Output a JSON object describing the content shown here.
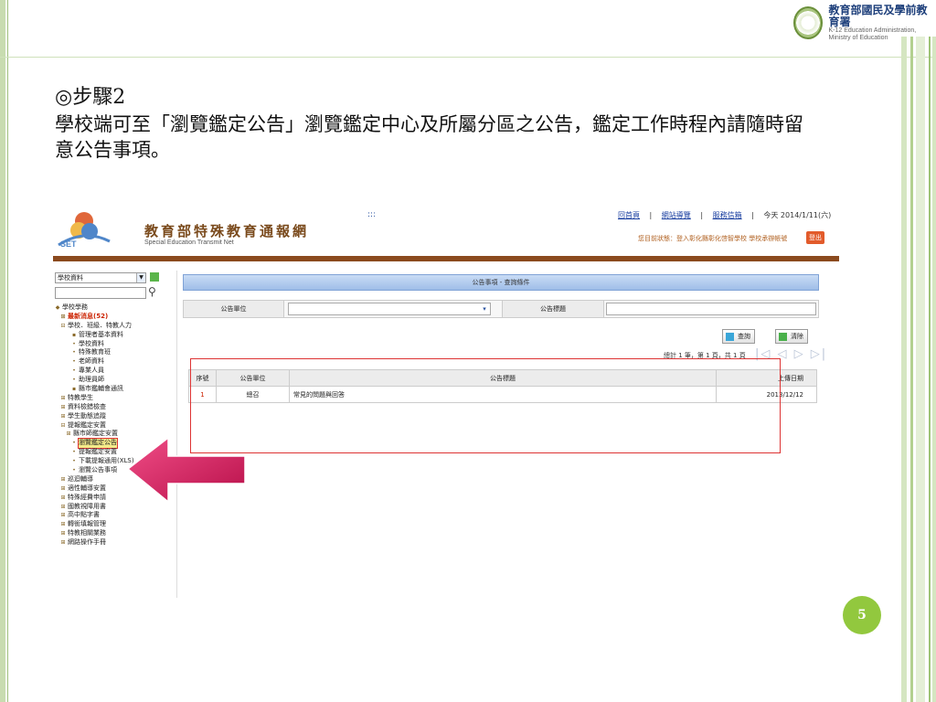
{
  "slide": {
    "step_title": "◎步驟2",
    "description": "學校端可至「瀏覽鑑定公告」瀏覽鑑定中心及所屬分區之公告，鑑定工作時程內請隨時留意公告事項。",
    "page_number": "5",
    "logo": {
      "zh": "教育部國民及學前教育署",
      "en1": "K-12 Education Administration,",
      "en2": "Ministry of Education"
    }
  },
  "site": {
    "title": "教育部特殊教育通報網",
    "subtitle": "Special Education Transmit Net",
    "logo_text": "SET",
    "dots": ":::",
    "top_links": [
      "回首頁",
      "網站導覽",
      "服務信箱"
    ],
    "sep": "|",
    "date_text": "今天 2014/1/11(六)",
    "status": "您目前狀態：登入彰化縣彰化啓智學校 學校承辦帳號",
    "logout": "登出"
  },
  "sidebar": {
    "select_value": "學校資料",
    "tree": [
      {
        "label": "學校學務",
        "cls": "",
        "ind": 0,
        "icon": "◆"
      },
      {
        "label": "最新消息(52)",
        "cls": "red",
        "ind": 1,
        "icon": "⊞"
      },
      {
        "label": "學校．班級．特教人力",
        "cls": "",
        "ind": 1,
        "icon": "⊟"
      },
      {
        "label": "管理者基本資料",
        "cls": "",
        "ind": 3,
        "icon": "▪"
      },
      {
        "label": "學校資料",
        "cls": "",
        "ind": 3,
        "icon": "•"
      },
      {
        "label": "特殊教育班",
        "cls": "",
        "ind": 3,
        "icon": "•"
      },
      {
        "label": "老師資料",
        "cls": "",
        "ind": 3,
        "icon": "•"
      },
      {
        "label": "專業人員",
        "cls": "",
        "ind": 3,
        "icon": "•"
      },
      {
        "label": "助理員師",
        "cls": "",
        "ind": 3,
        "icon": "•"
      },
      {
        "label": "縣市鑑輔會通訊",
        "cls": "",
        "ind": 3,
        "icon": "▪"
      },
      {
        "label": "特教學生",
        "cls": "",
        "ind": 1,
        "icon": "⊞"
      },
      {
        "label": "資料檢錯檢查",
        "cls": "",
        "ind": 1,
        "icon": "⊞"
      },
      {
        "label": "學生動態追蹤",
        "cls": "",
        "ind": 1,
        "icon": "⊞"
      },
      {
        "label": "提報鑑定安置",
        "cls": "",
        "ind": 1,
        "icon": "⊟"
      },
      {
        "label": "縣市師鑑定安置",
        "cls": "",
        "ind": 2,
        "icon": "⊞"
      },
      {
        "label": "瀏覽鑑定公告",
        "cls": "hl",
        "ind": 3,
        "icon": "•"
      },
      {
        "label": "提報鑑定安置",
        "cls": "",
        "ind": 3,
        "icon": "•"
      },
      {
        "label": "下載提報通用(XLS)",
        "cls": "",
        "ind": 3,
        "icon": "•"
      },
      {
        "label": "瀏覽公告事項",
        "cls": "",
        "ind": 3,
        "icon": "•"
      },
      {
        "label": "巡迴輔導",
        "cls": "",
        "ind": 1,
        "icon": "⊞"
      },
      {
        "label": "適性輔導安置",
        "cls": "",
        "ind": 1,
        "icon": "⊞"
      },
      {
        "label": "特殊經費申請",
        "cls": "",
        "ind": 1,
        "icon": "⊞"
      },
      {
        "label": "國教視障用書",
        "cls": "",
        "ind": 1,
        "icon": "⊞"
      },
      {
        "label": "高中點字書",
        "cls": "",
        "ind": 1,
        "icon": "⊞"
      },
      {
        "label": "轉銜填報管理",
        "cls": "",
        "ind": 1,
        "icon": "⊞"
      },
      {
        "label": "特教相關業務",
        "cls": "",
        "ind": 1,
        "icon": "⊞"
      },
      {
        "label": "網路操作手冊",
        "cls": "",
        "ind": 1,
        "icon": "⊞"
      }
    ]
  },
  "query": {
    "bar_title": "公告事項 - 查詢條件",
    "unit_label": "公告單位",
    "title_label": "公告標題",
    "search_button": "查詢",
    "clear_button": "清除",
    "pager_text": "總計 1 筆，第 1 頁，共 1 頁",
    "pager_icons": "|◁ ◁ ▷ ▷|"
  },
  "table": {
    "headers": [
      "序號",
      "公告單位",
      "公告標題",
      "上傳日期"
    ],
    "rows": [
      {
        "no": "1",
        "unit": "總召",
        "title": "常見的問題與回答",
        "date": "2013/12/12"
      }
    ]
  },
  "colors": {
    "accent_green": "#92c83e",
    "brown_band": "#8b4a1e",
    "arrow_pink": "#d4165a"
  }
}
